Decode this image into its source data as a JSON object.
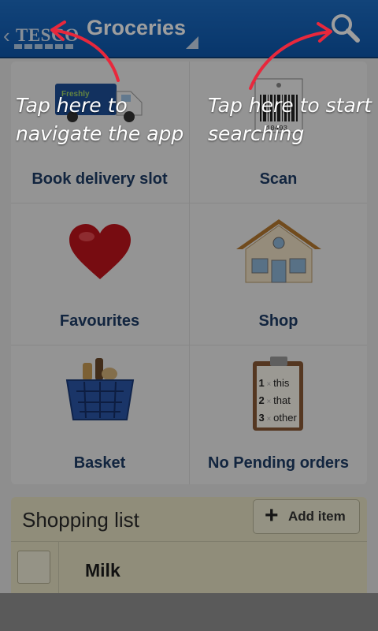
{
  "actionbar": {
    "logo_text": "TESCO",
    "title": "Groceries",
    "up_icon": "chevron-left-icon",
    "search_icon": "search-icon",
    "bar_color": "#1565c0"
  },
  "tiles": [
    {
      "label": "Book delivery slot",
      "icon": "delivery-van-icon",
      "van_text": "Freshly"
    },
    {
      "label": "Scan",
      "icon": "barcode-tag-icon",
      "barcode_digits": "10493"
    },
    {
      "label": "Favourites",
      "icon": "heart-icon"
    },
    {
      "label": "Shop",
      "icon": "house-icon"
    },
    {
      "label": "Basket",
      "icon": "shopping-basket-icon"
    },
    {
      "label": "No Pending orders",
      "icon": "clipboard-list-icon",
      "list_rows": [
        {
          "num": "1",
          "text": "this"
        },
        {
          "num": "2",
          "text": "that"
        },
        {
          "num": "3",
          "text": "other"
        }
      ]
    }
  ],
  "shopping_list": {
    "title": "Shopping list",
    "add_label": "Add item",
    "items": [
      {
        "label": "Milk"
      }
    ]
  },
  "tutorial": {
    "hint_nav": "Tap here to navigate the app",
    "hint_search": "Tap here to start searching",
    "arrow_color": "#e8283c"
  }
}
